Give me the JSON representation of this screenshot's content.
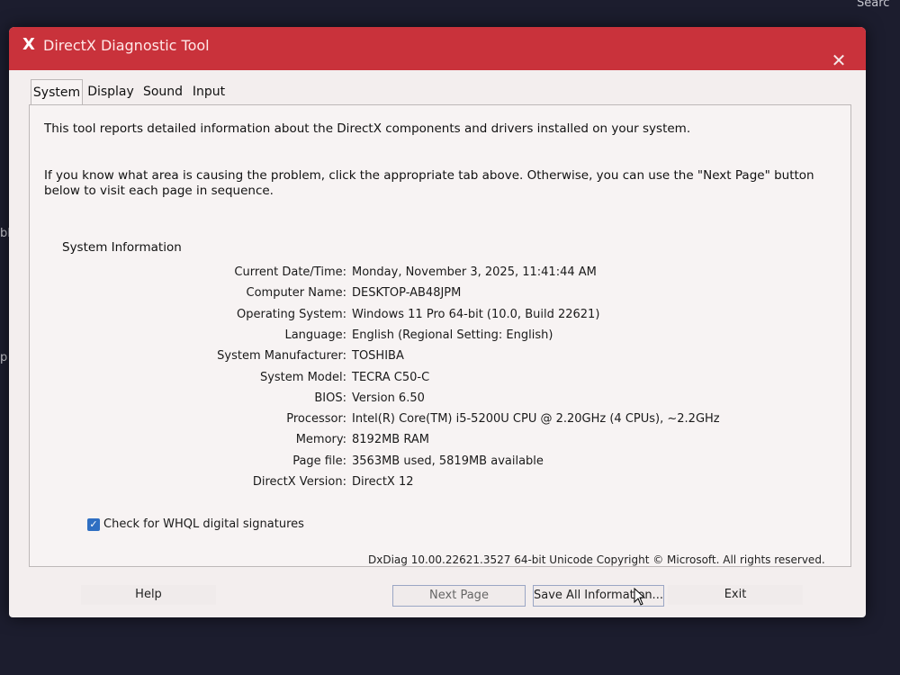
{
  "desktop": {
    "search_fragment": "Searc",
    "left_fragment_1": "ble",
    "left_fragment_2": "p"
  },
  "window": {
    "title": "DirectX Diagnostic Tool",
    "icon": "directx-x-icon",
    "close_glyph": "✕"
  },
  "tabs": [
    {
      "label": "System",
      "active": true
    },
    {
      "label": "Display"
    },
    {
      "label": "Sound"
    },
    {
      "label": "Input"
    }
  ],
  "intro": {
    "line1": "This tool reports detailed information about the DirectX components and drivers installed on your system.",
    "line2": "If you know what area is causing the problem, click the appropriate tab above.  Otherwise, you can use the \"Next Page\" button below to visit each page in sequence."
  },
  "system_info": {
    "title": "System Information",
    "rows": [
      {
        "label": "Current Date/Time:",
        "value": "Monday, November 3, 2025, 11:41:44 AM"
      },
      {
        "label": "Computer Name:",
        "value": "DESKTOP-AB48JPM"
      },
      {
        "label": "Operating System:",
        "value": "Windows 11 Pro 64-bit (10.0, Build 22621)"
      },
      {
        "label": "Language:",
        "value": "English (Regional Setting: English)"
      },
      {
        "label": "System Manufacturer:",
        "value": "TOSHIBA"
      },
      {
        "label": "System Model:",
        "value": "TECRA C50-C"
      },
      {
        "label": "BIOS:",
        "value": "Version 6.50"
      },
      {
        "label": "Processor:",
        "value": "Intel(R) Core(TM) i5-5200U CPU @ 2.20GHz (4 CPUs), ~2.2GHz"
      },
      {
        "label": "Memory:",
        "value": "8192MB RAM"
      },
      {
        "label": "Page file:",
        "value": "3563MB used, 5819MB available"
      },
      {
        "label": "DirectX Version:",
        "value": "DirectX 12"
      }
    ]
  },
  "whql": {
    "label": "Check for WHQL digital signatures",
    "checked": true
  },
  "copyright": "DxDiag 10.00.22621.3527 64-bit Unicode  Copyright © Microsoft. All rights reserved.",
  "buttons": {
    "help": "Help",
    "next": "Next Page",
    "save": "Save All Information...",
    "exit": "Exit"
  },
  "colors": {
    "titlebar": "#c9323b",
    "accent_check": "#2f6fc2"
  }
}
